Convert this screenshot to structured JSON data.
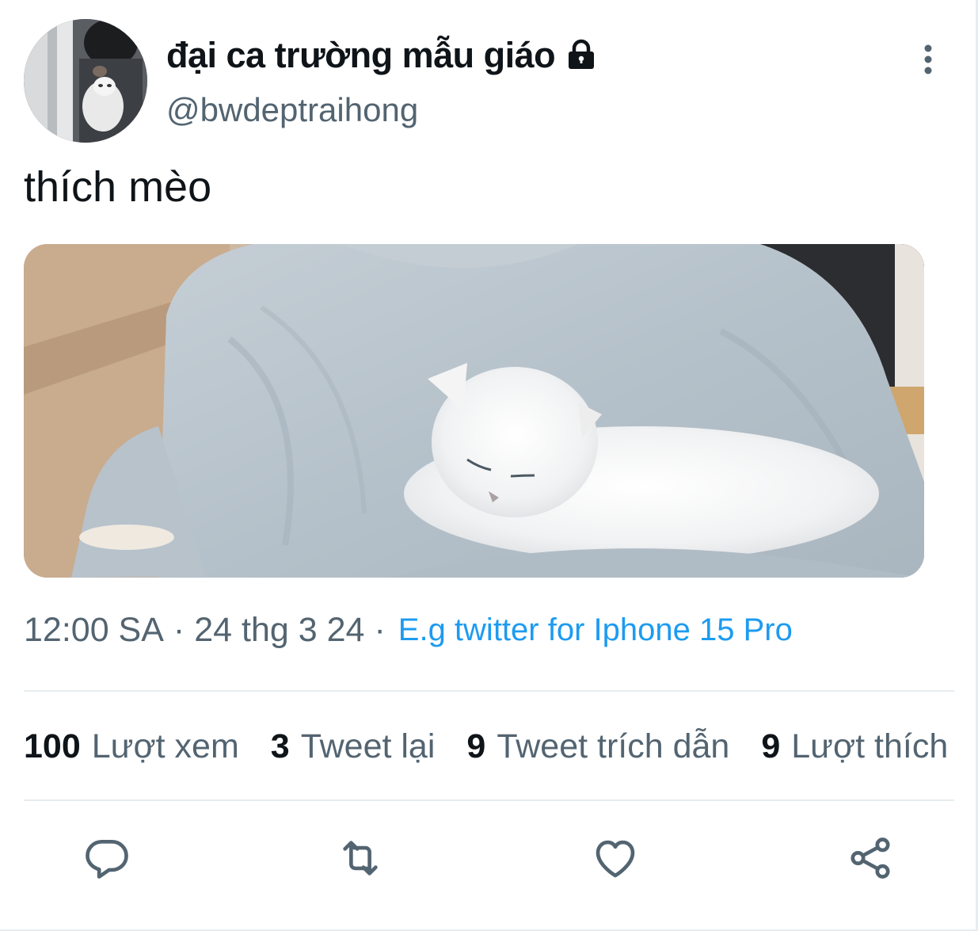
{
  "tweet": {
    "display_name": "đại ca trường mẫu giáo",
    "handle": "@bwdeptraihong",
    "protected_icon": "lock-icon",
    "text": "thích mèo",
    "time": "12:00 SA",
    "dot": "·",
    "date": "24 thg 3 24",
    "client_dot": "·",
    "client": "E.g twitter for Iphone 15 Pro"
  },
  "stats": [
    {
      "count": "100",
      "label": "Lượt xem"
    },
    {
      "count": "3",
      "label": "Tweet lại"
    },
    {
      "count": "9",
      "label": "Tweet trích dẫn"
    },
    {
      "count": "9",
      "label": "Lượt thích"
    }
  ],
  "actions": {
    "reply_icon": "reply-icon",
    "retweet_icon": "retweet-icon",
    "like_icon": "heart-icon",
    "share_icon": "share-icon"
  },
  "colors": {
    "text": "#0f1419",
    "secondary": "#536471",
    "link": "#1d9bf0",
    "divider": "#e6ecf0"
  }
}
